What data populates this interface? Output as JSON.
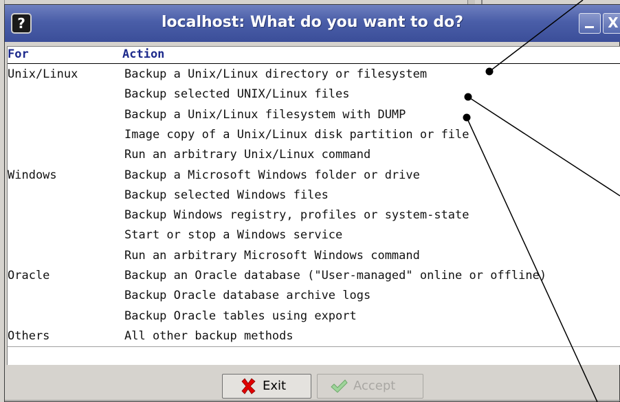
{
  "window": {
    "title": "localhost: What do you want to do?",
    "icon": "help-question-icon",
    "title_bar_color": "#4a5ea8",
    "title_buttons": {
      "minimize": "minimize-icon",
      "close_label": "X"
    }
  },
  "list": {
    "header_color": "#1d2a8c",
    "columns": {
      "for": "For",
      "action": "Action"
    },
    "rows": [
      {
        "for": "Unix/Linux",
        "action": "Backup a Unix/Linux directory or filesystem"
      },
      {
        "for": "",
        "action": "Backup selected UNIX/Linux files"
      },
      {
        "for": "",
        "action": "Backup a Unix/Linux filesystem with DUMP"
      },
      {
        "for": "",
        "action": "Image copy of a Unix/Linux disk partition or file"
      },
      {
        "for": "",
        "action": "Run an arbitrary Unix/Linux command"
      },
      {
        "for": "Windows",
        "action": "Backup a Microsoft Windows folder or drive"
      },
      {
        "for": "",
        "action": "Backup selected Windows files"
      },
      {
        "for": "",
        "action": "Backup Windows registry, profiles or system-state"
      },
      {
        "for": "",
        "action": "Start or stop a Windows service"
      },
      {
        "for": "",
        "action": "Run an arbitrary Microsoft Windows command"
      },
      {
        "for": "Oracle",
        "action": "Backup an Oracle database (\"User-managed\" online or offline)"
      },
      {
        "for": "",
        "action": "Backup Oracle database archive logs"
      },
      {
        "for": "",
        "action": "Backup Oracle tables using export"
      },
      {
        "for": "Others",
        "action": "All other backup methods"
      }
    ]
  },
  "buttons": {
    "exit": {
      "label": "Exit",
      "icon": "red-x-icon",
      "color": "#e00000"
    },
    "accept": {
      "label": "Accept",
      "icon": "checkmark-icon",
      "enabled": false
    }
  }
}
